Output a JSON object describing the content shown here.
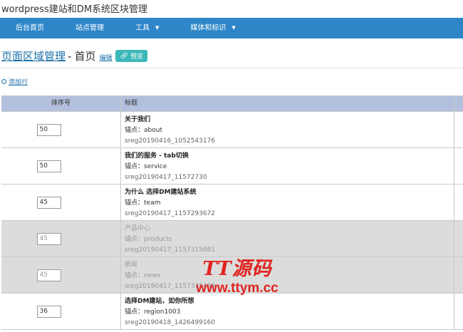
{
  "app": {
    "title": "wordpress建站和DM系统区块管理"
  },
  "nav": {
    "items": [
      {
        "label": "后台首页"
      },
      {
        "label": "站点管理"
      },
      {
        "label": "工具",
        "caret": "▼"
      },
      {
        "label": "媒体和标识",
        "caret": "▼"
      }
    ]
  },
  "page": {
    "section_link": "页面区域管理",
    "separator": "-",
    "name": "首页",
    "edit_label": "编辑",
    "preview_label": "预览",
    "add_row_label": "添加行"
  },
  "table": {
    "headers": {
      "order": "排序号",
      "title": "标题"
    },
    "anchor_prefix": "锚点：",
    "rows": [
      {
        "order": "50",
        "title": "关于我们",
        "anchor": "about",
        "id": "sreg20190416_1052543176",
        "disabled": false
      },
      {
        "order": "50",
        "title": "我们的服务 - tab切换",
        "anchor": "service",
        "id": "sreg20190417_11572730",
        "disabled": false
      },
      {
        "order": "45",
        "title": "为什么 选择DM建站系统",
        "anchor": "team",
        "id": "sreg20190417_1157293672",
        "disabled": false
      },
      {
        "order": "45",
        "title": "产品中心",
        "anchor": "products",
        "id": "sreg20190417_1157315681",
        "disabled": true
      },
      {
        "order": "45",
        "title": "新闻",
        "anchor": "news",
        "id": "sreg20190417_1157335489",
        "disabled": true
      },
      {
        "order": "36",
        "title": "选择DM建站，如你所想",
        "anchor": "region1003",
        "id": "sreg20190418_1426499160",
        "disabled": false
      }
    ]
  },
  "watermark": {
    "brand": "TT源码",
    "url": "www.ttym.cc"
  },
  "colors": {
    "navbar": "#2e86c8",
    "header_row": "#b3c0dd",
    "preview_button": "#3bb7b9",
    "watermark": "#e0231f",
    "link": "#1a6fa8"
  }
}
